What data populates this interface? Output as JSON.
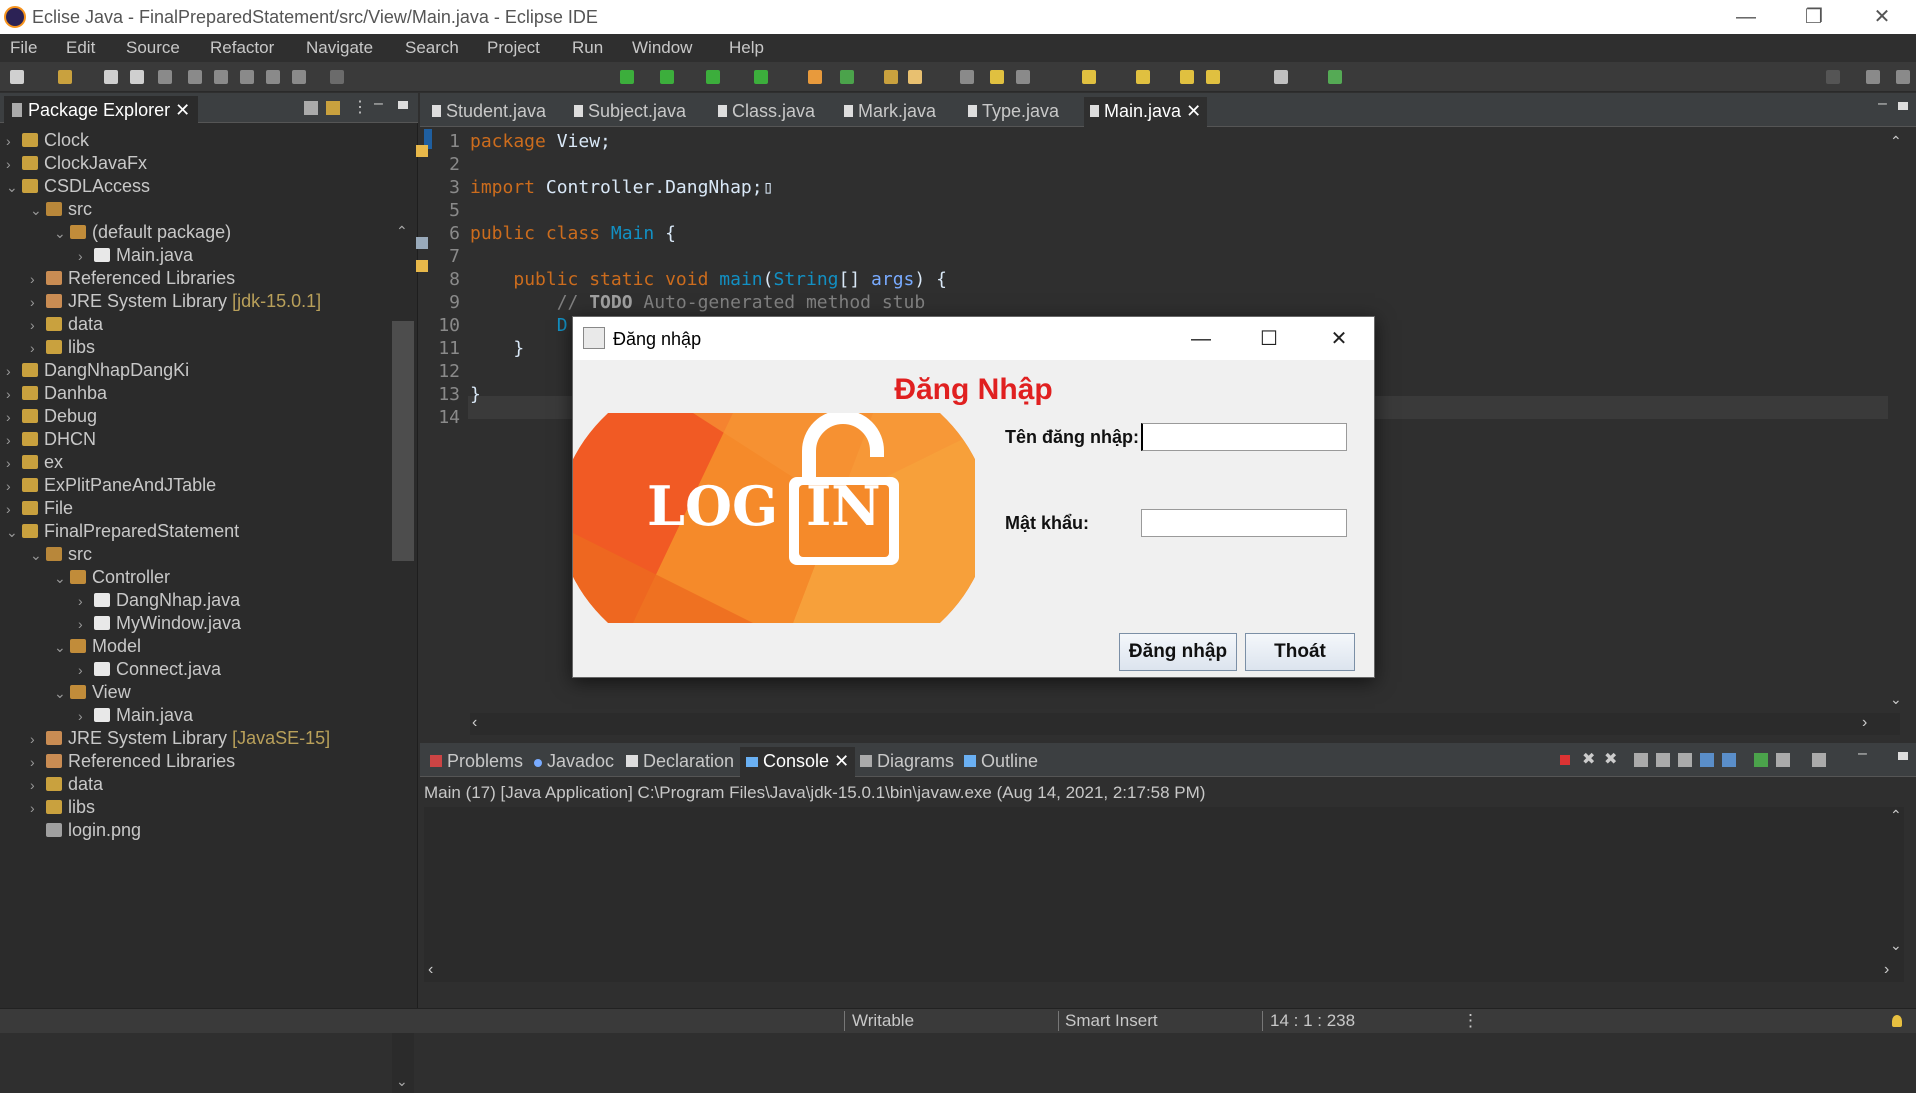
{
  "window": {
    "title": "Eclise Java - FinalPreparedStatement/src/View/Main.java - Eclipse IDE",
    "minimize": "—",
    "maximize": "❐",
    "close": "✕"
  },
  "menu": [
    "File",
    "Edit",
    "Source",
    "Refactor",
    "Navigate",
    "Search",
    "Project",
    "Run",
    "Window",
    "Help"
  ],
  "package_explorer": {
    "title": "Package Explorer",
    "items": [
      {
        "label": "Clock",
        "deco": ""
      },
      {
        "label": "ClockJavaFx",
        "deco": ""
      },
      {
        "label": "CSDLAccess",
        "deco": ""
      },
      {
        "label": "src",
        "deco": ""
      },
      {
        "label": "(default package)",
        "deco": ""
      },
      {
        "label": "Main.java",
        "deco": ""
      },
      {
        "label": "Referenced Libraries",
        "deco": ""
      },
      {
        "label": "JRE System Library",
        "deco": "[jdk-15.0.1]"
      },
      {
        "label": "data",
        "deco": ""
      },
      {
        "label": "libs",
        "deco": ""
      },
      {
        "label": "DangNhapDangKi",
        "deco": ""
      },
      {
        "label": "Danhba",
        "deco": ""
      },
      {
        "label": "Debug",
        "deco": ""
      },
      {
        "label": "DHCN",
        "deco": ""
      },
      {
        "label": "ex",
        "deco": ""
      },
      {
        "label": "ExPlitPaneAndJTable",
        "deco": ""
      },
      {
        "label": "File",
        "deco": ""
      },
      {
        "label": "FinalPreparedStatement",
        "deco": ""
      },
      {
        "label": "src",
        "deco": ""
      },
      {
        "label": "Controller",
        "deco": ""
      },
      {
        "label": "DangNhap.java",
        "deco": ""
      },
      {
        "label": "MyWindow.java",
        "deco": ""
      },
      {
        "label": "Model",
        "deco": ""
      },
      {
        "label": "Connect.java",
        "deco": ""
      },
      {
        "label": "View",
        "deco": ""
      },
      {
        "label": "Main.java",
        "deco": ""
      },
      {
        "label": "JRE System Library",
        "deco": "[JavaSE-15]"
      },
      {
        "label": "Referenced Libraries",
        "deco": ""
      },
      {
        "label": "data",
        "deco": ""
      },
      {
        "label": "libs",
        "deco": ""
      },
      {
        "label": "login.png",
        "deco": ""
      }
    ]
  },
  "editor": {
    "tabs": [
      "Student.java",
      "Subject.java",
      "Class.java",
      "Mark.java",
      "Type.java",
      "Main.java"
    ],
    "active_tab": "Main.java",
    "line_numbers": [
      "1",
      "2",
      "3",
      "5",
      "6",
      "7",
      "8",
      "9",
      "10",
      "11",
      "12",
      "13",
      "14"
    ]
  },
  "console": {
    "tabs": [
      "Problems",
      "Javadoc",
      "Declaration",
      "Console",
      "Diagrams",
      "Outline"
    ],
    "active_tab": "Console",
    "info": "Main (17) [Java Application] C:\\Program Files\\Java\\jdk-15.0.1\\bin\\javaw.exe  (Aug 14, 2021, 2:17:58 PM)"
  },
  "statusbar": {
    "writable": "Writable",
    "insert_mode": "Smart Insert",
    "position": "14 : 1 : 238"
  },
  "dialog": {
    "title": "Đăng nhập",
    "heading": "Đăng Nhập",
    "username_label": "Tên đăng nhập:",
    "username_value": "",
    "password_label": "Mật khẩu:",
    "password_value": "",
    "login_button": "Đăng nhập",
    "exit_button": "Thoát",
    "art_text_left": "LOG",
    "art_text_right": "IN",
    "minimize": "—",
    "maximize": "☐",
    "close": "✕"
  },
  "colors": {
    "heading_red": "#e02020",
    "keyword_orange": "#cc6c1d",
    "type_blue": "#1290c3",
    "art_orange": "#f37021"
  }
}
